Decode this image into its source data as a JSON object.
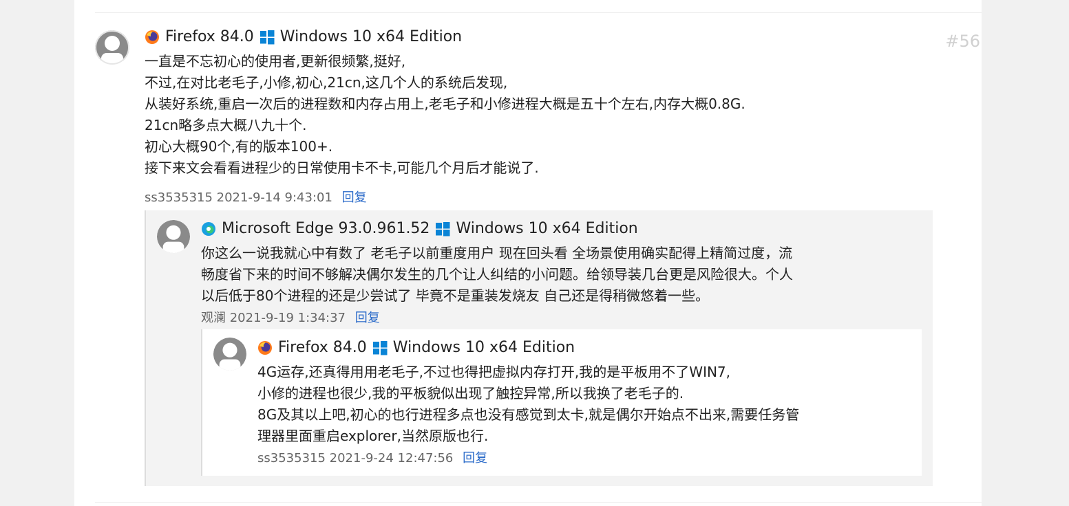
{
  "comment": {
    "browser": "Firefox 84.0",
    "os": "Windows 10 x64 Edition",
    "floor": "#56",
    "lines": [
      "一直是不忘初心的使用者,更新很频繁,挺好,",
      "不过,在对比老毛子,小修,初心,21cn,这几个人的系统后发现,",
      "从装好系统,重启一次后的进程数和内存占用上,老毛子和小修进程大概是五十个左右,内存大概0.8G.",
      "21cn略多点大概八九十个.",
      "初心大概90个,有的版本100+.",
      "接下来文会看看进程少的日常使用卡不卡,可能几个月后才能说了."
    ],
    "author": "ss3535315",
    "time": "2021-9-14 9:43:01",
    "reply_label": "回复"
  },
  "reply1": {
    "browser": "Microsoft Edge 93.0.961.52",
    "os": "Windows 10 x64 Edition",
    "lines": [
      "你这么一说我就心中有数了 老毛子以前重度用户 现在回头看 全场景使用确实配得上精简过度，流",
      "畅度省下来的时间不够解决偶尔发生的几个让人纠结的小问题。给领导装几台更是风险很大。个人",
      "以后低于80个进程的还是少尝试了 毕竟不是重装发烧友 自己还是得稍微悠着一些。"
    ],
    "author": "观澜",
    "time": "2021-9-19 1:34:37",
    "reply_label": "回复"
  },
  "reply2": {
    "browser": "Firefox 84.0",
    "os": "Windows 10 x64 Edition",
    "lines": [
      "4G运存,还真得用用老毛子,不过也得把虚拟内存打开,我的是平板用不了WIN7,",
      "小修的进程也很少,我的平板貌似出现了触控异常,所以我换了老毛子的.",
      "8G及其以上吧,初心的也行进程多点也没有感觉到太卡,就是偶尔开始点不出来,需要任务管",
      "理器里面重启explorer,当然原版也行."
    ],
    "author": "ss3535315",
    "time": "2021-9-24 12:47:56",
    "reply_label": "回复"
  },
  "colors": {
    "link": "#2a6ac9",
    "windows_blue": "#0a84d6",
    "avatar_gray": "#8a8a8a"
  },
  "icons": {
    "firefox": "firefox-icon",
    "edge": "edge-icon",
    "windows": "windows-icon",
    "avatar": "default-avatar-icon"
  }
}
